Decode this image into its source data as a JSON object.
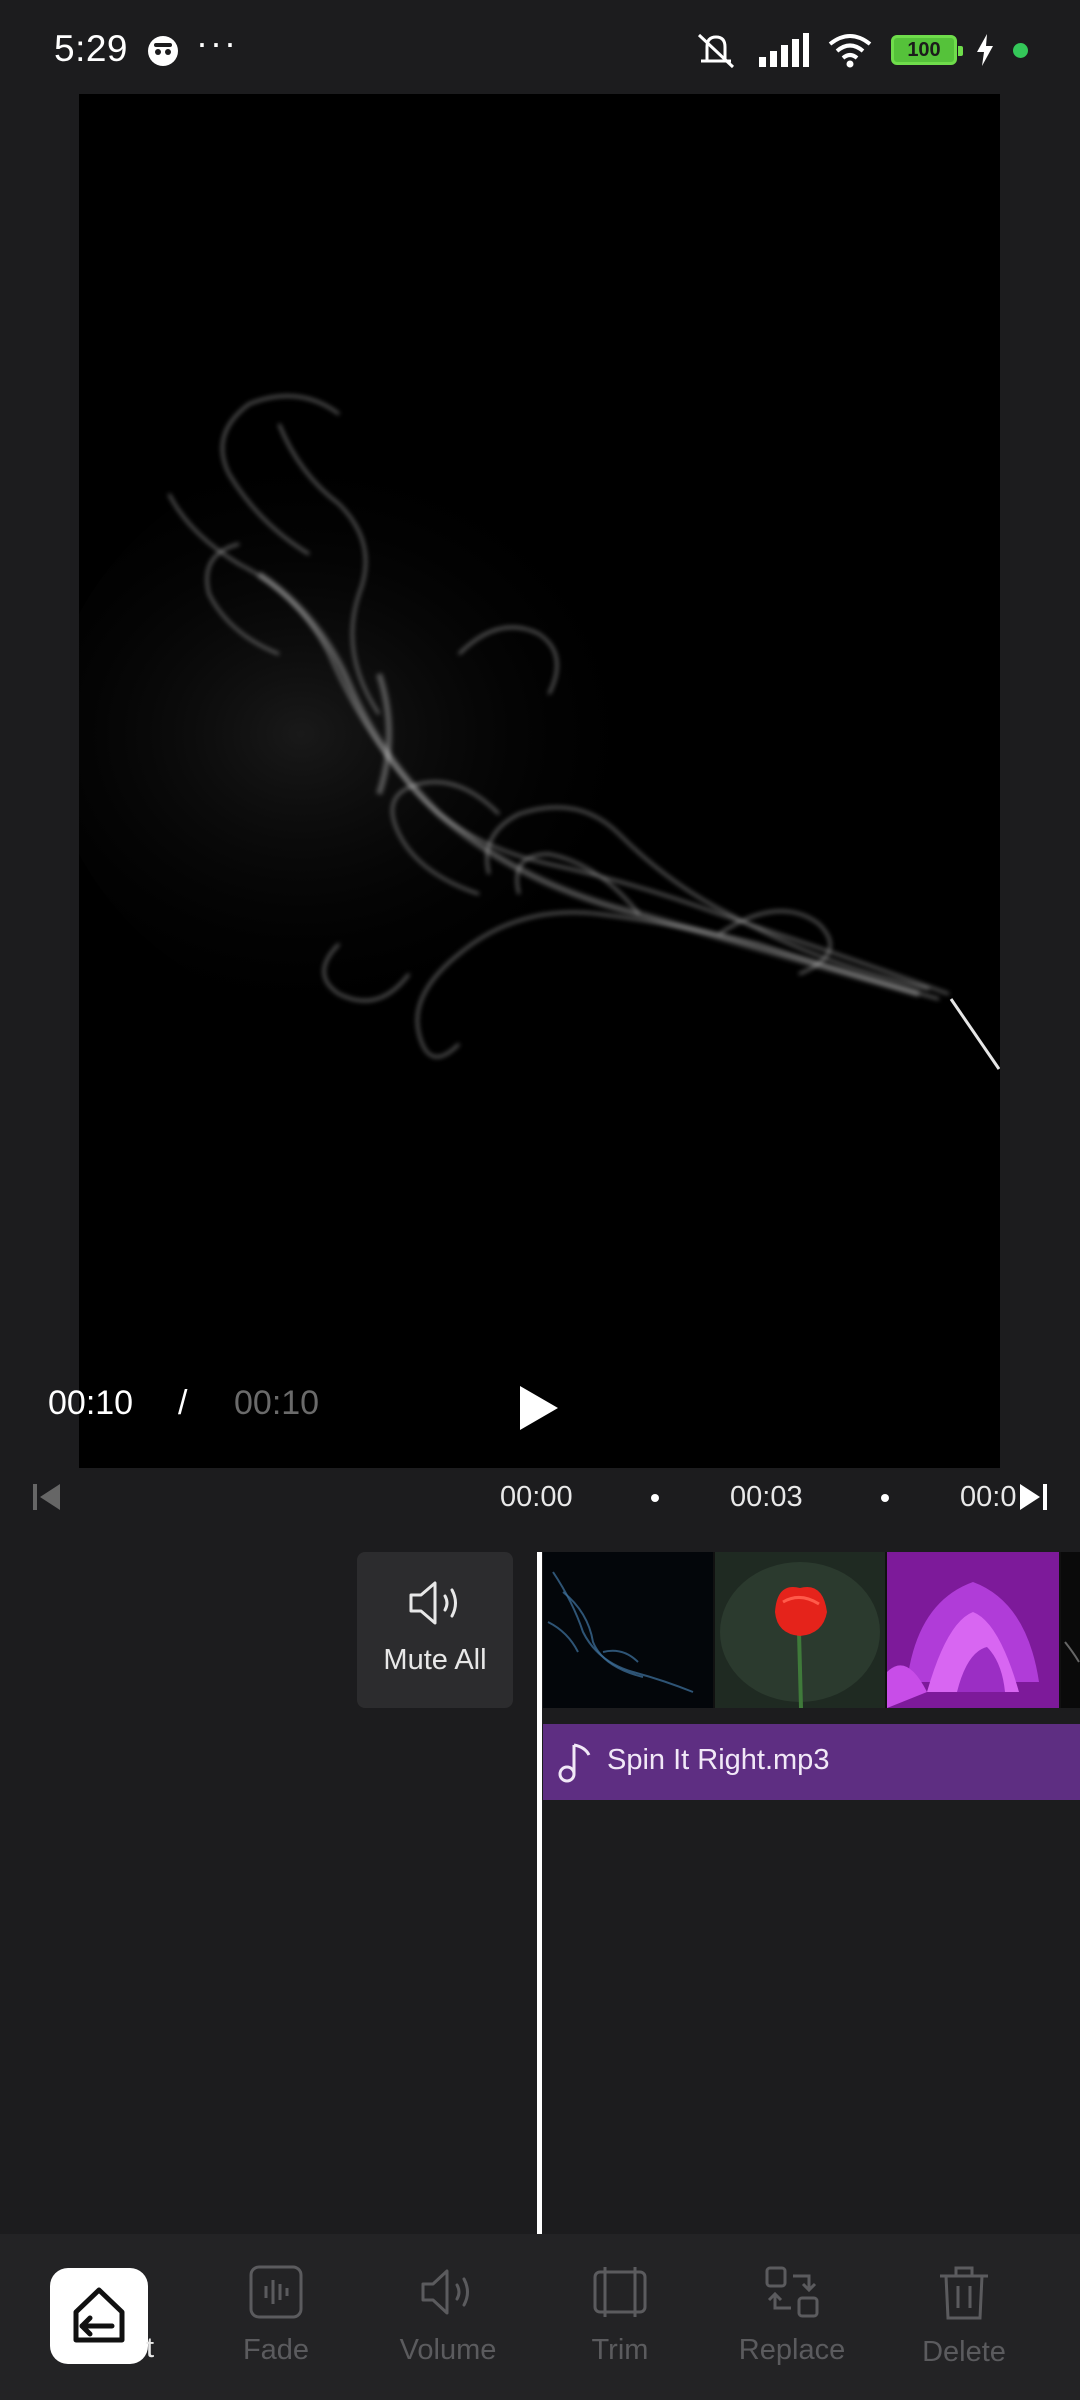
{
  "status_bar": {
    "time": "5:29",
    "more": "···",
    "battery": "100",
    "icons": [
      "app-icon",
      "mute-icon",
      "signal-icon",
      "wifi-icon",
      "battery-icon",
      "charging-icon",
      "green-dot"
    ]
  },
  "player": {
    "current_time": "00:10",
    "separator": "/",
    "total_time": "00:10"
  },
  "ruler": {
    "ticks": [
      "00:00",
      "00:03",
      "00:0"
    ]
  },
  "timeline": {
    "mute_all_label": "Mute All",
    "audio_track_name": "Spin It Right.mp3"
  },
  "toolbar": {
    "exit_label_fragment": "t",
    "tools": [
      {
        "label": "Fade",
        "icon": "fade-icon"
      },
      {
        "label": "Volume",
        "icon": "volume-icon"
      },
      {
        "label": "Trim",
        "icon": "trim-icon"
      },
      {
        "label": "Replace",
        "icon": "replace-icon"
      },
      {
        "label": "Delete",
        "icon": "delete-icon"
      }
    ]
  },
  "colors": {
    "background": "#1c1c1e",
    "audio_track": "#5e2e82",
    "battery": "#55c23a",
    "inactive_label": "#5b5b5e"
  }
}
